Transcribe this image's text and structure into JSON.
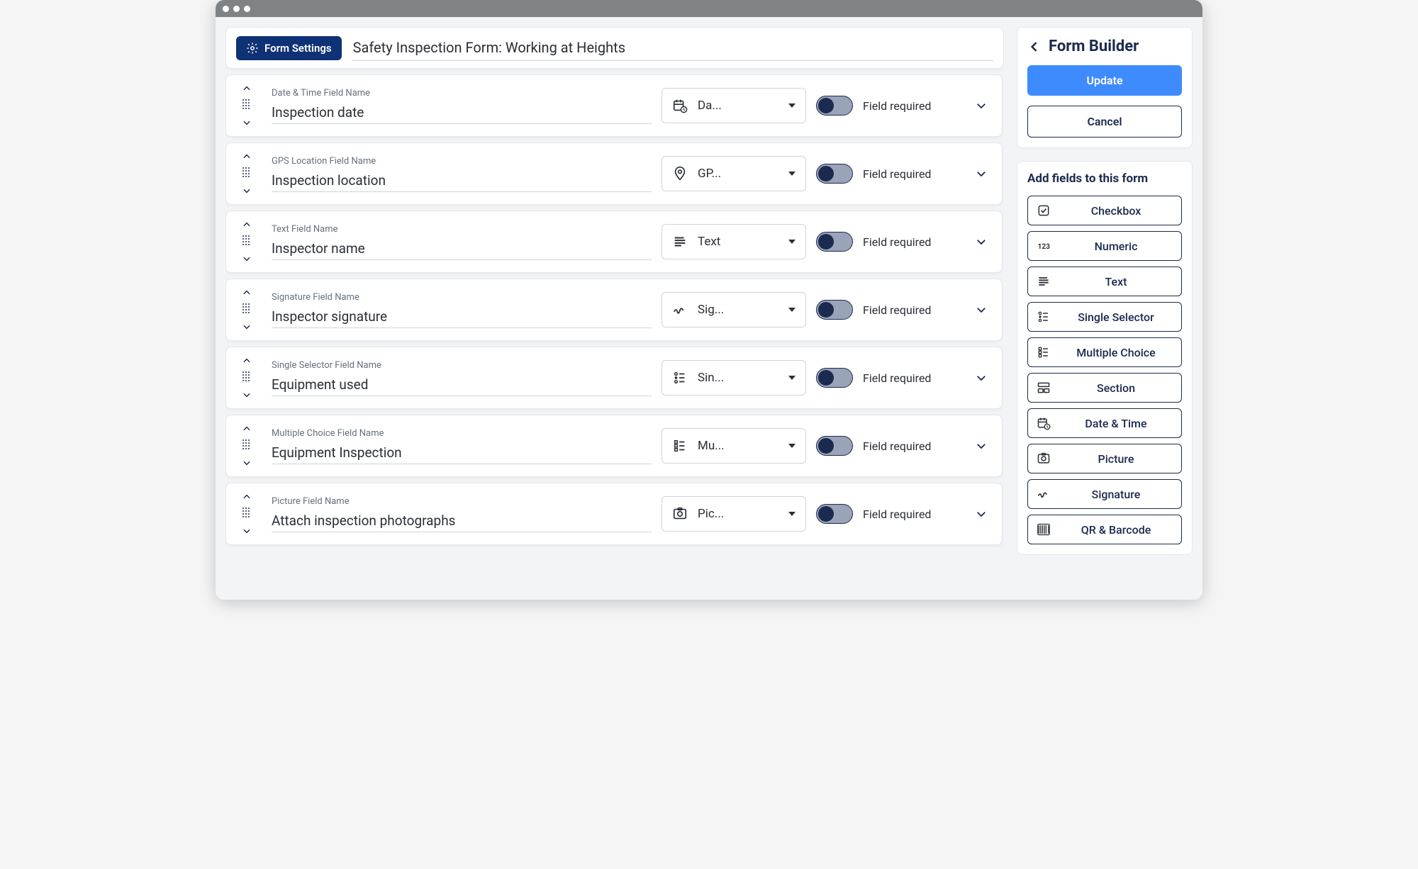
{
  "header": {
    "settings_label": "Form Settings",
    "form_title": "Safety Inspection Form: Working at Heights"
  },
  "sidebar": {
    "title": "Form Builder",
    "update_label": "Update",
    "cancel_label": "Cancel",
    "add_fields_title": "Add fields to this form",
    "palette": [
      {
        "label": "Checkbox",
        "icon": "checkbox"
      },
      {
        "label": "Numeric",
        "icon": "numeric"
      },
      {
        "label": "Text",
        "icon": "text"
      },
      {
        "label": "Single Selector",
        "icon": "single-selector"
      },
      {
        "label": "Multiple Choice",
        "icon": "multiple-choice"
      },
      {
        "label": "Section",
        "icon": "section"
      },
      {
        "label": "Date & Time",
        "icon": "datetime"
      },
      {
        "label": "Picture",
        "icon": "picture"
      },
      {
        "label": "Signature",
        "icon": "signature"
      },
      {
        "label": "QR & Barcode",
        "icon": "barcode"
      }
    ]
  },
  "fields": [
    {
      "label": "Date & Time Field Name",
      "value": "Inspection date",
      "type_display": "Da...",
      "type_icon": "datetime",
      "required": true,
      "required_label": "Field required"
    },
    {
      "label": "GPS Location Field Name",
      "value": "Inspection location",
      "type_display": "GP...",
      "type_icon": "gps",
      "required": true,
      "required_label": "Field required"
    },
    {
      "label": "Text Field Name",
      "value": "Inspector name",
      "type_display": "Text",
      "type_icon": "text",
      "required": true,
      "required_label": "Field required"
    },
    {
      "label": "Signature Field Name",
      "value": "Inspector signature",
      "type_display": "Sig...",
      "type_icon": "signature",
      "required": true,
      "required_label": "Field required"
    },
    {
      "label": "Single Selector Field Name",
      "value": "Equipment used",
      "type_display": "Sin...",
      "type_icon": "single-selector",
      "required": true,
      "required_label": "Field required"
    },
    {
      "label": "Multiple Choice Field Name",
      "value": "Equipment Inspection",
      "type_display": "Mu...",
      "type_icon": "multiple-choice",
      "required": true,
      "required_label": "Field required"
    },
    {
      "label": "Picture Field Name",
      "value": "Attach inspection photographs",
      "type_display": "Pic...",
      "type_icon": "picture",
      "required": true,
      "required_label": "Field required"
    }
  ],
  "colors": {
    "brand_dark": "#1b2a4e",
    "brand_blue": "#3d8bff"
  }
}
